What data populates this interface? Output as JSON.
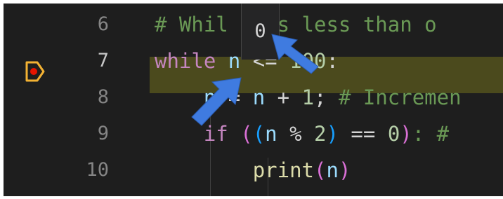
{
  "editor": {
    "lines": [
      {
        "number": "6",
        "tokens": [
          {
            "text": "# Whil",
            "cls": "cm"
          },
          {
            "text": "   ",
            "cls": ""
          },
          {
            "text": "is less than o",
            "cls": "cm"
          }
        ]
      },
      {
        "number": "7",
        "tokens": [
          {
            "text": "while ",
            "cls": "kw"
          },
          {
            "text": "n",
            "cls": "var"
          },
          {
            "text": " <= ",
            "cls": ""
          },
          {
            "text": "100",
            "cls": "num"
          },
          {
            "text": ":",
            "cls": ""
          }
        ]
      },
      {
        "number": "8",
        "tokens": [
          {
            "text": "    ",
            "cls": ""
          },
          {
            "text": "n",
            "cls": "var"
          },
          {
            "text": " = ",
            "cls": ""
          },
          {
            "text": "n",
            "cls": "var"
          },
          {
            "text": " + ",
            "cls": ""
          },
          {
            "text": "1",
            "cls": "num"
          },
          {
            "text": "; ",
            "cls": ""
          },
          {
            "text": "# Incremen",
            "cls": "cm"
          }
        ]
      },
      {
        "number": "9",
        "tokens": [
          {
            "text": "    ",
            "cls": ""
          },
          {
            "text": "if",
            "cls": "kw"
          },
          {
            "text": " ",
            "cls": ""
          },
          {
            "text": "(",
            "cls": "br1"
          },
          {
            "text": "(",
            "cls": "br2"
          },
          {
            "text": "n",
            "cls": "var"
          },
          {
            "text": " % ",
            "cls": ""
          },
          {
            "text": "2",
            "cls": "num"
          },
          {
            "text": ")",
            "cls": "br2"
          },
          {
            "text": " == ",
            "cls": ""
          },
          {
            "text": "0",
            "cls": "num"
          },
          {
            "text": ")",
            "cls": "br1"
          },
          {
            "text": ": # ",
            "cls": "cm"
          }
        ]
      },
      {
        "number": "10",
        "tokens": [
          {
            "text": "        ",
            "cls": ""
          },
          {
            "text": "print",
            "cls": "fn"
          },
          {
            "text": "(",
            "cls": "br1"
          },
          {
            "text": "n",
            "cls": "var"
          },
          {
            "text": ")",
            "cls": "br1"
          }
        ]
      }
    ],
    "current_line": "7"
  },
  "hover": {
    "value": "0"
  },
  "icons": {
    "breakpoint": "breakpoint-paused-icon",
    "annotation": "arrow-pointer-icon"
  },
  "colors": {
    "current_line_bg": "#4b4a1d",
    "breakpoint": "#f3b233",
    "arrow": "#3f7be0"
  }
}
